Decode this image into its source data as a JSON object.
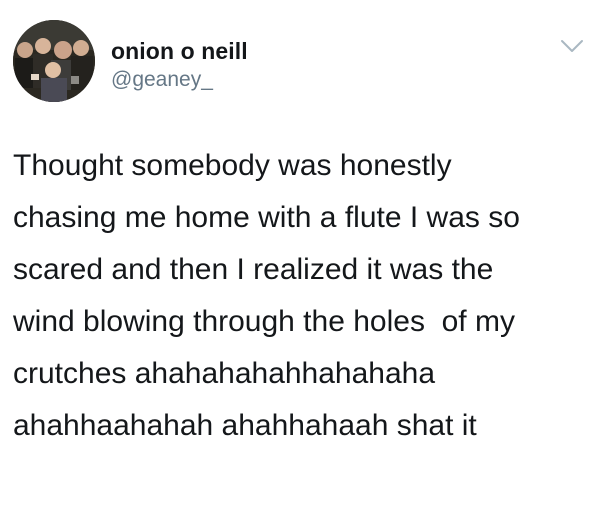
{
  "tweet": {
    "author": {
      "display_name": "onion o neill",
      "handle": "@geaney_",
      "avatar_icon": "avatar-group-photo"
    },
    "menu_icon": "chevron-down-icon",
    "text_lines": [
      "Thought somebody was honestly",
      "chasing me home with a flute I was so",
      "scared and then I realized it was the",
      "wind blowing through the holes  of my",
      "crutches ahahahahahhahahaha",
      "ahahhaahahah ahahhahaah shat it"
    ]
  },
  "colors": {
    "text": "#14171a",
    "secondary": "#657786",
    "chevron": "#aab8c2",
    "background": "#ffffff"
  }
}
